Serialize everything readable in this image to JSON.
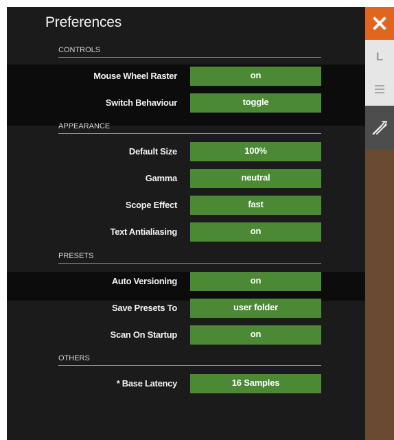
{
  "window": {
    "title": "Preferences"
  },
  "sidebar": {
    "close_icon": "close-icon",
    "layout_letter": "L",
    "menu_icon": "hamburger-menu-icon",
    "tools_icon": "wrench-screwdriver-icon"
  },
  "sections": {
    "controls": {
      "header": "CONTROLS",
      "rows": [
        {
          "label": "Mouse Wheel Raster",
          "value": "on"
        },
        {
          "label": "Switch Behaviour",
          "value": "toggle"
        }
      ]
    },
    "appearance": {
      "header": "APPEARANCE",
      "rows": [
        {
          "label": "Default Size",
          "value": "100%"
        },
        {
          "label": "Gamma",
          "value": "neutral"
        },
        {
          "label": "Scope Effect",
          "value": "fast"
        },
        {
          "label": "Text Antialiasing",
          "value": "on"
        }
      ]
    },
    "presets": {
      "header": "PRESETS",
      "rows": [
        {
          "label": "Auto Versioning",
          "value": "on"
        },
        {
          "label": "Save Presets To",
          "value": "user folder"
        },
        {
          "label": "Scan On Startup",
          "value": "on"
        }
      ]
    },
    "others": {
      "header": "OTHERS",
      "rows": [
        {
          "label": "* Base Latency",
          "value": "16 Samples"
        }
      ]
    }
  },
  "colors": {
    "panel_background": "#1b1b1b",
    "value_field": "#4b8935",
    "close_button": "#e0651e",
    "sidebar_background": "#6a4a31",
    "tab_inactive": "#e6e6e6",
    "tab_active": "#4d4d4d"
  }
}
